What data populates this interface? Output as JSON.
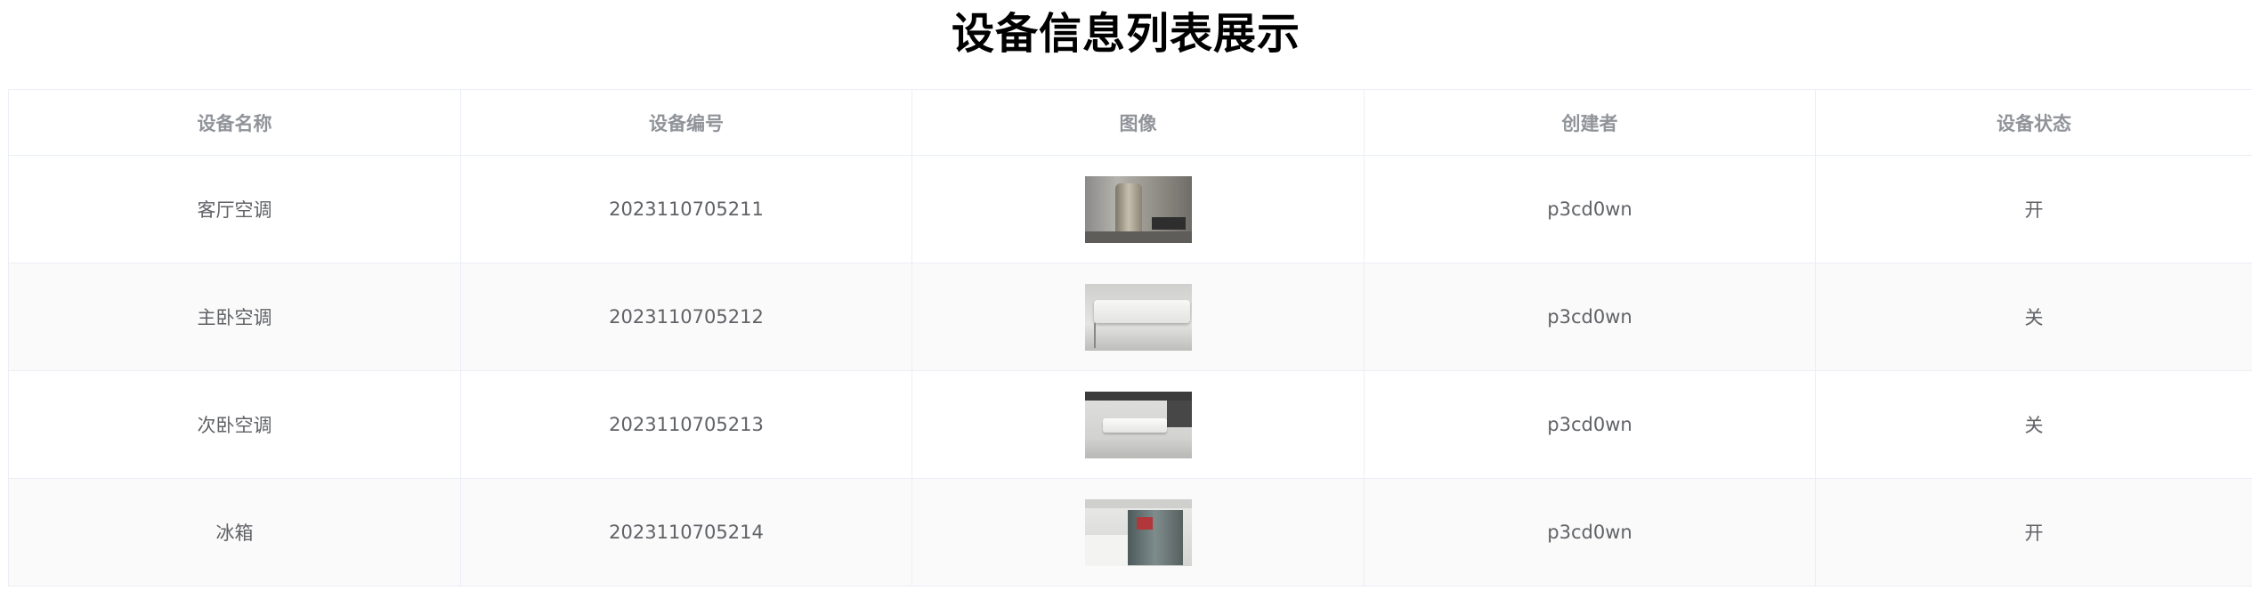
{
  "page": {
    "title": "设备信息列表展示"
  },
  "table": {
    "columns": [
      "设备名称",
      "设备编号",
      "图像",
      "创建者",
      "设备状态"
    ],
    "rows": [
      {
        "name": "客厅空调",
        "code": "2023110705211",
        "image": "living-room-ac-photo",
        "creator": "p3cd0wn",
        "status": "开"
      },
      {
        "name": "主卧空调",
        "code": "2023110705212",
        "image": "master-bedroom-ac-photo",
        "creator": "p3cd0wn",
        "status": "关"
      },
      {
        "name": "次卧空调",
        "code": "2023110705213",
        "image": "second-bedroom-ac-photo",
        "creator": "p3cd0wn",
        "status": "关"
      },
      {
        "name": "冰箱",
        "code": "2023110705214",
        "image": "refrigerator-photo",
        "creator": "p3cd0wn",
        "status": "开"
      }
    ]
  }
}
